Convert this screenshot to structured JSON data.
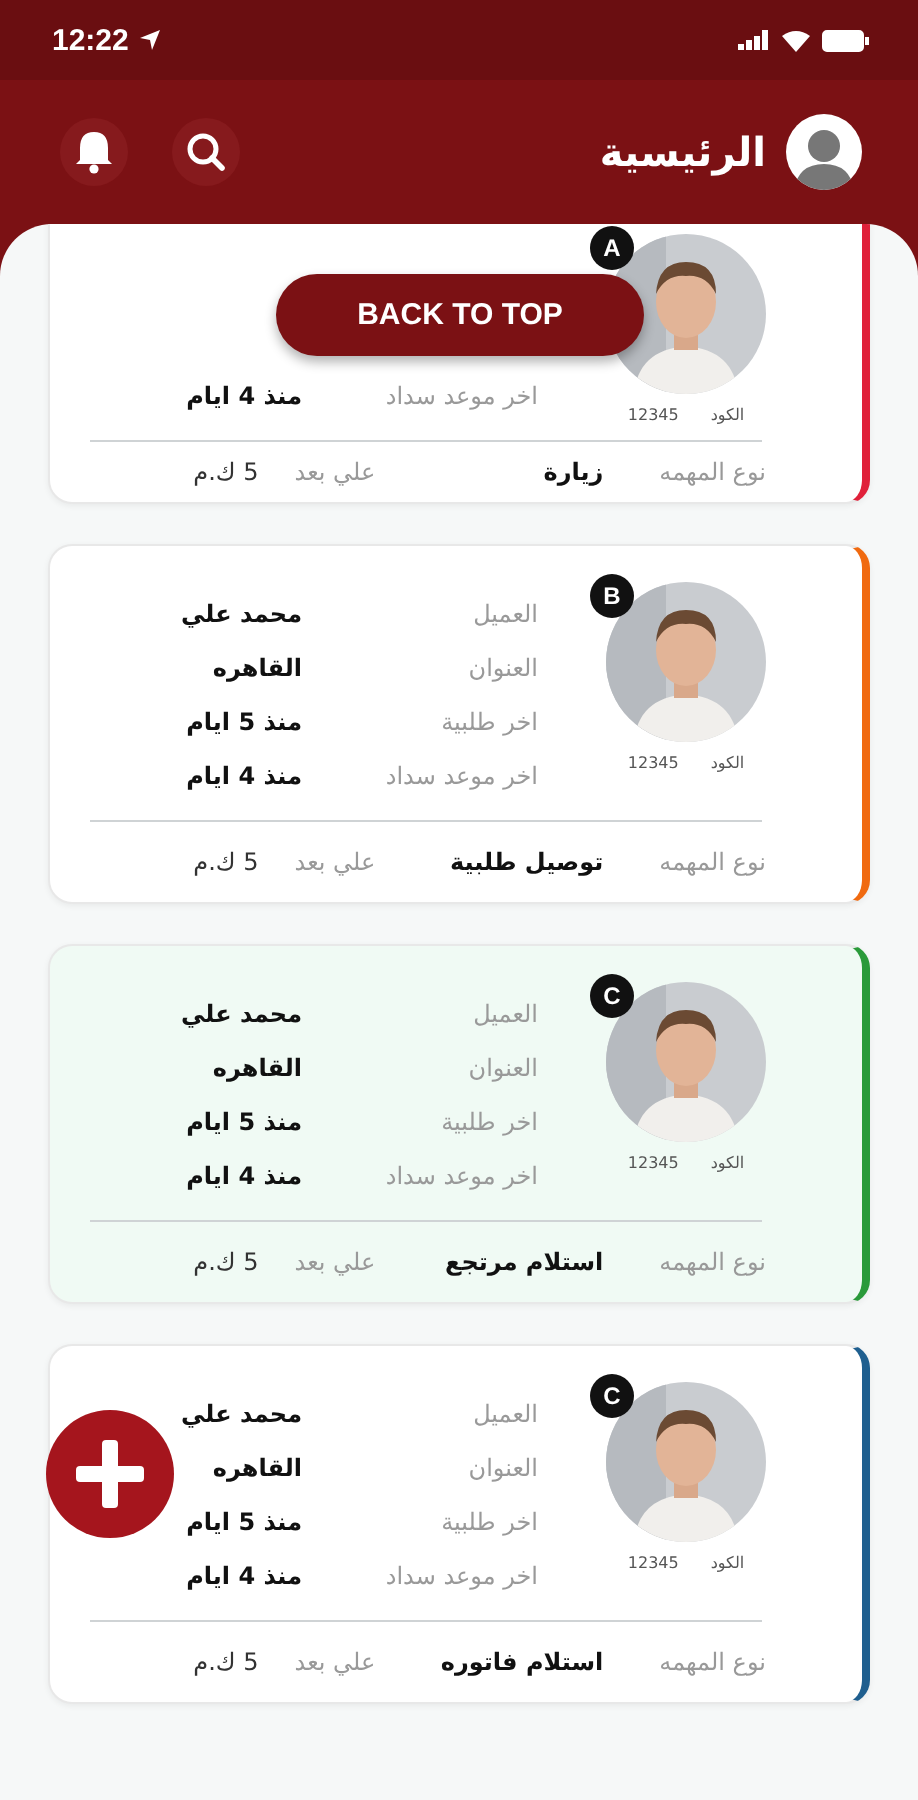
{
  "status_bar": {
    "time": "12:22"
  },
  "header": {
    "title": "الرئيسية"
  },
  "back_to_top": {
    "label": "BACK TO TOP"
  },
  "cards": [
    {
      "badge": "A",
      "color": "#e0203a",
      "selected": false,
      "code_label": "الكود",
      "code": "12345",
      "rows": [
        {
          "label": "اخر موعد سداد",
          "value": "منذ 4 ايام"
        }
      ],
      "task_label": "نوع المهمه",
      "task": "زيارة",
      "distance_label": "علي بعد",
      "distance": "5 ك.م"
    },
    {
      "badge": "B",
      "color": "#f06a10",
      "selected": false,
      "code_label": "الكود",
      "code": "12345",
      "rows": [
        {
          "label": "العميل",
          "value": "محمد علي"
        },
        {
          "label": "العنوان",
          "value": "القاهره"
        },
        {
          "label": "اخر طلبية",
          "value": "منذ 5 ايام"
        },
        {
          "label": "اخر موعد سداد",
          "value": "منذ 4 ايام"
        }
      ],
      "task_label": "نوع المهمه",
      "task": "توصيل طلبية",
      "distance_label": "علي بعد",
      "distance": "5 ك.م"
    },
    {
      "badge": "C",
      "color": "#2a9a3a",
      "selected": true,
      "code_label": "الكود",
      "code": "12345",
      "rows": [
        {
          "label": "العميل",
          "value": "محمد علي"
        },
        {
          "label": "العنوان",
          "value": "القاهره"
        },
        {
          "label": "اخر طلبية",
          "value": "منذ 5 ايام"
        },
        {
          "label": "اخر موعد سداد",
          "value": "منذ 4 ايام"
        }
      ],
      "task_label": "نوع المهمه",
      "task": "استلام مرتجع",
      "distance_label": "علي بعد",
      "distance": "5 ك.م"
    },
    {
      "badge": "C",
      "color": "#1f5f8f",
      "selected": false,
      "code_label": "الكود",
      "code": "12345",
      "rows": [
        {
          "label": "العميل",
          "value": "محمد علي"
        },
        {
          "label": "العنوان",
          "value": "القاهره"
        },
        {
          "label": "اخر طلبية",
          "value": "منذ 5 ايام"
        },
        {
          "label": "اخر موعد سداد",
          "value": "منذ 4 ايام"
        }
      ],
      "task_label": "نوع المهمه",
      "task": "استلام فاتوره",
      "distance_label": "علي بعد",
      "distance": "5 ك.م"
    }
  ]
}
